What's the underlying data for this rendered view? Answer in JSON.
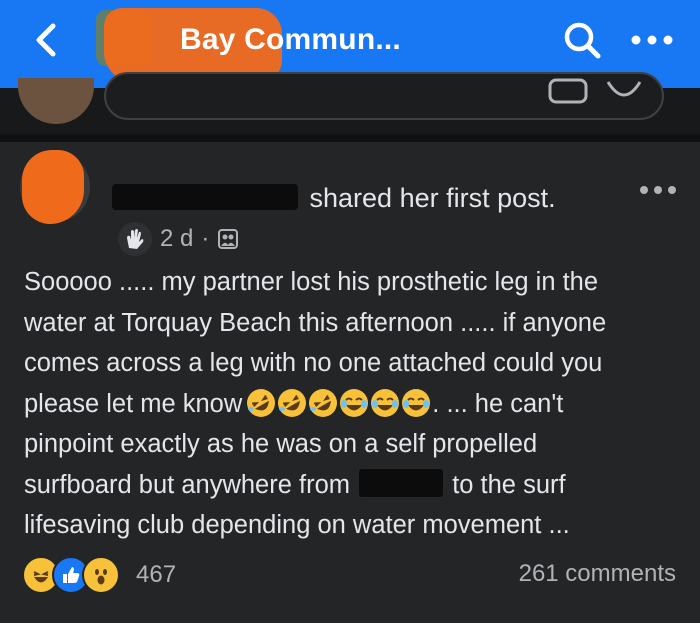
{
  "header": {
    "group_title_visible": "Bay Commun...",
    "back_icon": "chevron-left-icon",
    "search_icon": "search-icon",
    "more_icon": "more-dots-icon"
  },
  "post": {
    "author_name": "",
    "action_text": "shared her first post.",
    "time": "2 d",
    "separator": "·",
    "audience_icon": "group-audience-icon",
    "badge_icon": "new-member-wave-icon",
    "body": {
      "line1": "Sooooo ..... my partner lost his prosthetic leg in the",
      "line2": "water at Torquay Beach this afternoon ..... if anyone",
      "line3": "comes across a leg with no one attached could you",
      "line4_pre": "please let me know",
      "line4_post": ". ... he can't",
      "line5": "pinpoint exactly as he was on a self propelled",
      "line6_pre": "surfboard but anywhere from",
      "line6_post": "to the surf",
      "line7": "lifesaving club depending on water movement ..."
    },
    "emojis": [
      "rolling-on-floor-laughing",
      "rolling-on-floor-laughing",
      "rolling-on-floor-laughing",
      "tears-of-joy",
      "tears-of-joy",
      "tears-of-joy"
    ],
    "reactions": {
      "types": [
        "haha",
        "like",
        "wow"
      ],
      "count": "467"
    },
    "comments": "261 comments"
  },
  "colors": {
    "brand_blue": "#1877f2",
    "background": "#18191a",
    "card": "#242526",
    "text_primary": "#e4e6eb",
    "text_secondary": "#b0b3b8",
    "redaction_orange": "#f06a1c"
  }
}
